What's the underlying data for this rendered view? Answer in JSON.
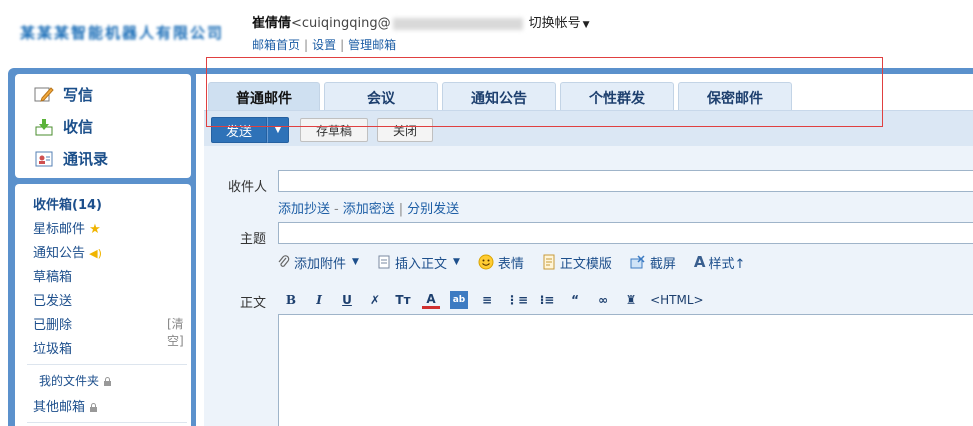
{
  "header": {
    "company_logo": "某某某智能机器人有限公司",
    "user_name": "崔倩倩",
    "user_email_prefix": "<cuiqingqing@",
    "switch_account": "切换帐号",
    "links": [
      "邮箱首页",
      "设置",
      "管理邮箱"
    ]
  },
  "sidebar": {
    "compose": "写信",
    "receive": "收信",
    "contacts": "通讯录",
    "folders": {
      "inbox": "收件箱(14)",
      "starred": "星标邮件",
      "notice": "通知公告",
      "drafts": "草稿箱",
      "sent": "已发送",
      "deleted": "已删除",
      "clear": "[清空]",
      "junk": "垃圾箱",
      "my_folders": "我的文件夹",
      "other_mailboxes": "其他邮箱"
    }
  },
  "tabs": [
    "普通邮件",
    "会议",
    "通知公告",
    "个性群发",
    "保密邮件"
  ],
  "toolbar": {
    "send": "发送",
    "save_draft": "存草稿",
    "close": "关闭"
  },
  "form": {
    "to_label": "收件人",
    "to_value": "",
    "links": [
      "添加抄送",
      "添加密送",
      "分别发送"
    ],
    "subject_label": "主题",
    "subject_value": "",
    "attach": "添加附件",
    "insert_body": "插入正文",
    "emoji": "表情",
    "template": "正文模版",
    "screenshot": "截屏",
    "style": "样式↑",
    "body_label": "正文",
    "html_toggle": "<HTML>"
  },
  "colors": {
    "frame_blue": "#5b91cc",
    "tab_bg": "#e3edf8",
    "send_blue": "#2e72b8",
    "annotation_red": "#e04040"
  }
}
